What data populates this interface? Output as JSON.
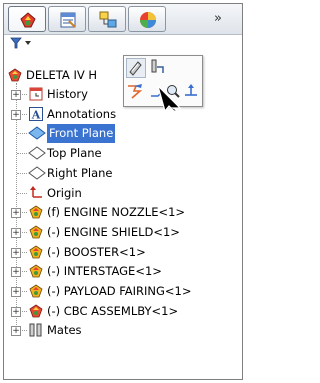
{
  "toolbar": {
    "tabs": [
      {
        "icon": "feature-manager-icon"
      },
      {
        "icon": "property-manager-icon"
      },
      {
        "icon": "configuration-manager-icon"
      },
      {
        "icon": "display-manager-icon"
      }
    ],
    "more": "»"
  },
  "filter": {
    "icon": "filter-icon",
    "dropdown": "▾"
  },
  "tree": {
    "root": "DELETA IV H",
    "items": [
      {
        "label": "History",
        "icon": "history-icon",
        "expandable": true
      },
      {
        "label": "Annotations",
        "icon": "annotations-icon",
        "expandable": true
      },
      {
        "label": "Front Plane",
        "icon": "plane-icon",
        "expandable": false,
        "selected": true
      },
      {
        "label": "Top Plane",
        "icon": "plane-icon",
        "expandable": false
      },
      {
        "label": "Right Plane",
        "icon": "plane-icon",
        "expandable": false
      },
      {
        "label": "Origin",
        "icon": "origin-icon",
        "expandable": false
      },
      {
        "label": "(f) ENGINE NOZZLE<1>",
        "icon": "part-icon",
        "expandable": true
      },
      {
        "label": "(-) ENGINE SHIELD<1>",
        "icon": "part-icon",
        "expandable": true
      },
      {
        "label": "(-) BOOSTER<1>",
        "icon": "part-icon",
        "expandable": true
      },
      {
        "label": "(-) INTERSTAGE<1>",
        "icon": "part-icon",
        "expandable": true
      },
      {
        "label": "(-) PAYLOAD FAIRING<1>",
        "icon": "part-icon",
        "expandable": true
      },
      {
        "label": "(-) CBC ASSEMLBY<1>",
        "icon": "assembly-icon",
        "expandable": true
      },
      {
        "label": "Mates",
        "icon": "mates-icon",
        "expandable": true
      }
    ]
  },
  "context_toolbar": {
    "buttons": [
      "insert-components-icon",
      "mate-icon",
      "edit-sketch-icon",
      "normal-to-icon",
      "zoom-to-selection-icon",
      "reference-geometry-icon"
    ]
  }
}
